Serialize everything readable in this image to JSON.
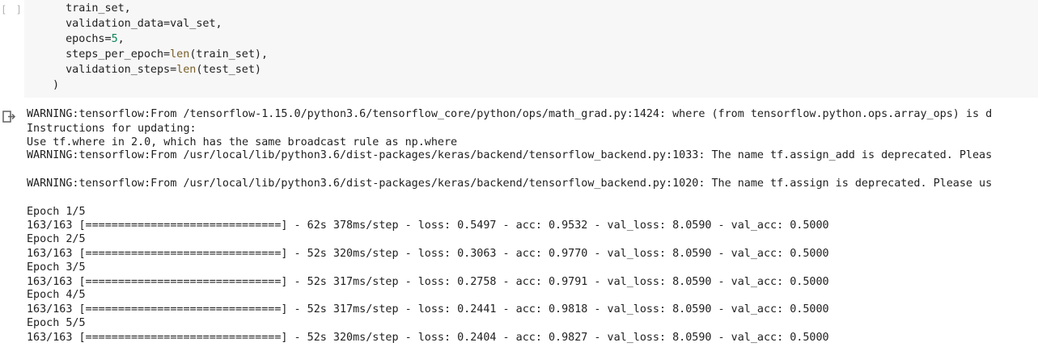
{
  "code_cell": {
    "run_indicator": "[ ]",
    "lines": [
      "train_set,",
      "validation_data=val_set,",
      "epochs=5,",
      "steps_per_epoch=len(train_set),",
      "validation_steps=len(test_set)",
      ")"
    ],
    "segments": {
      "l0": "  train_set,",
      "l1": "  validation_data=val_set,",
      "l2a": "  epochs=",
      "l2b": "5",
      "l2c": ",",
      "l3a": "  steps_per_epoch=",
      "l3b": "len",
      "l3c": "(train_set),",
      "l4a": "  validation_steps=",
      "l4b": "len",
      "l4c": "(test_set)",
      "l5": ")"
    }
  },
  "output_cell": {
    "icon": "output-redirect-icon",
    "lines": [
      "WARNING:tensorflow:From /tensorflow-1.15.0/python3.6/tensorflow_core/python/ops/math_grad.py:1424: where (from tensorflow.python.ops.array_ops) is d",
      "Instructions for updating:",
      "Use tf.where in 2.0, which has the same broadcast rule as np.where",
      "WARNING:tensorflow:From /usr/local/lib/python3.6/dist-packages/keras/backend/tensorflow_backend.py:1033: The name tf.assign_add is deprecated. Pleas",
      "",
      "WARNING:tensorflow:From /usr/local/lib/python3.6/dist-packages/keras/backend/tensorflow_backend.py:1020: The name tf.assign is deprecated. Please us",
      "",
      "Epoch 1/5",
      "163/163 [==============================] - 62s 378ms/step - loss: 0.5497 - acc: 0.9532 - val_loss: 8.0590 - val_acc: 0.5000",
      "Epoch 2/5",
      "163/163 [==============================] - 52s 320ms/step - loss: 0.3063 - acc: 0.9770 - val_loss: 8.0590 - val_acc: 0.5000",
      "Epoch 3/5",
      "163/163 [==============================] - 52s 317ms/step - loss: 0.2758 - acc: 0.9791 - val_loss: 8.0590 - val_acc: 0.5000",
      "Epoch 4/5",
      "163/163 [==============================] - 52s 317ms/step - loss: 0.2441 - acc: 0.9818 - val_loss: 8.0590 - val_acc: 0.5000",
      "Epoch 5/5",
      "163/163 [==============================] - 52s 320ms/step - loss: 0.2404 - acc: 0.9827 - val_loss: 8.0590 - val_acc: 0.5000"
    ]
  }
}
